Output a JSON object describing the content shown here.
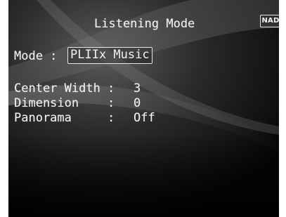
{
  "screen": {
    "title": "Listening Mode",
    "logo_text": "NAD",
    "mode": {
      "label": "Mode :",
      "value": "PLIIx Music"
    },
    "settings": [
      {
        "label": "Center Width :",
        "value": "3"
      },
      {
        "label": "Dimension    :",
        "value": "0"
      },
      {
        "label": "Panorama     :",
        "value": "Off"
      }
    ]
  },
  "colors": {
    "background": "#0a0a0a",
    "text": "#f2f2f2",
    "highlight_border": "#e6e6e6"
  }
}
